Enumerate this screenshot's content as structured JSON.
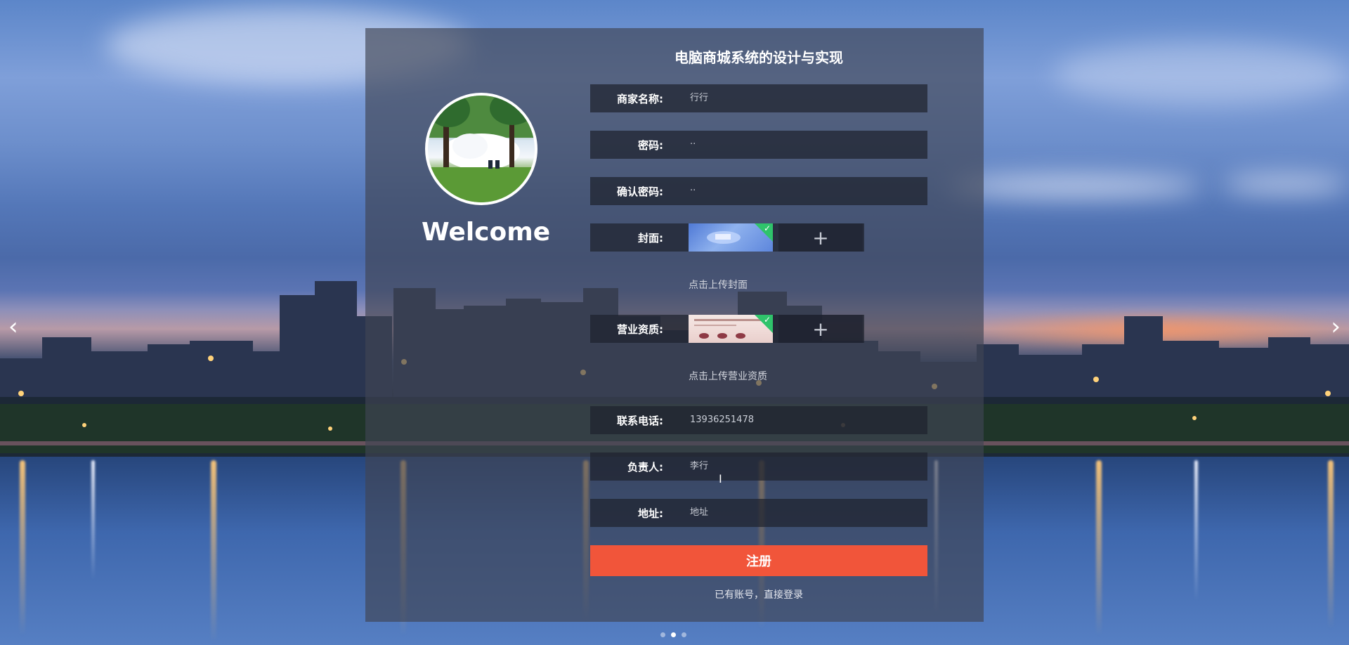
{
  "panel": {
    "title": "电脑商城系统的设计与实现",
    "welcome": "Welcome"
  },
  "form": {
    "merchant_name": {
      "label": "商家名称:",
      "value": "行行"
    },
    "password": {
      "label": "密码:",
      "value": "··"
    },
    "confirm_password": {
      "label": "确认密码:",
      "value": "··"
    },
    "cover": {
      "label": "封面:",
      "hint": "点击上传封面",
      "plus": "+"
    },
    "license": {
      "label": "营业资质:",
      "hint": "点击上传营业资质",
      "plus": "+"
    },
    "phone": {
      "label": "联系电话:",
      "value": "13936251478"
    },
    "contact": {
      "label": "负责人:",
      "value": "李行"
    },
    "address": {
      "label": "地址:",
      "value": "地址"
    },
    "submit": "注册",
    "login_link": "已有账号，直接登录"
  },
  "carousel": {
    "prev_icon": "‹",
    "next_icon": "›",
    "active_index": 1,
    "dot_count": 3
  },
  "colors": {
    "accent": "#f1553a",
    "upload_ok": "#2fc36b"
  }
}
